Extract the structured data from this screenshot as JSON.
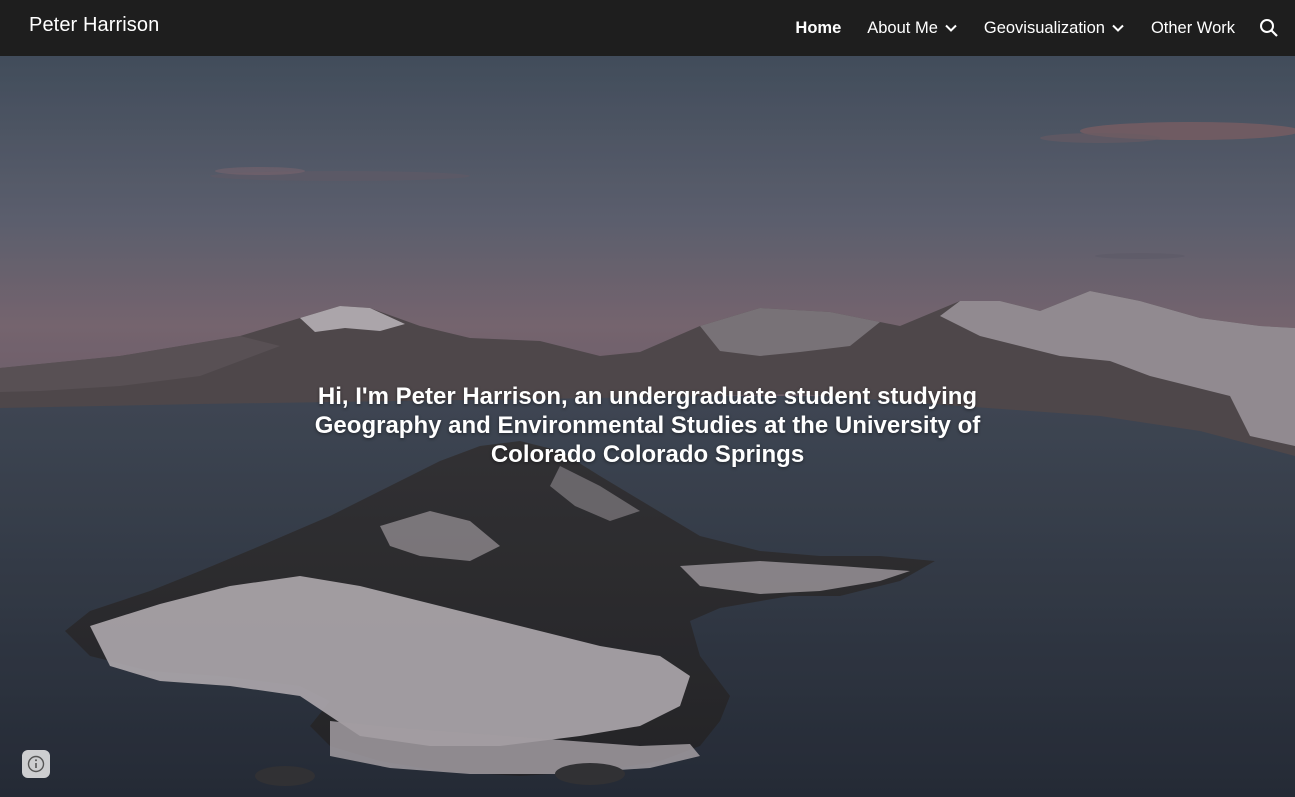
{
  "header": {
    "site_title": "Peter Harrison",
    "nav": [
      {
        "label": "Home",
        "active": true,
        "has_dropdown": false
      },
      {
        "label": "About Me",
        "active": false,
        "has_dropdown": true
      },
      {
        "label": "Geovisualization",
        "active": false,
        "has_dropdown": true
      },
      {
        "label": "Other Work",
        "active": false,
        "has_dropdown": false
      }
    ],
    "search_icon": "search-icon"
  },
  "hero": {
    "heading": "Hi, I'm Peter Harrison, an undergraduate student studying Geography and Environmental Studies at the University of Colorado Colorado Springs"
  },
  "footer": {
    "info_icon": "info-icon"
  },
  "colors": {
    "header_bg": "#1e1e1e",
    "header_text": "#ffffff"
  }
}
